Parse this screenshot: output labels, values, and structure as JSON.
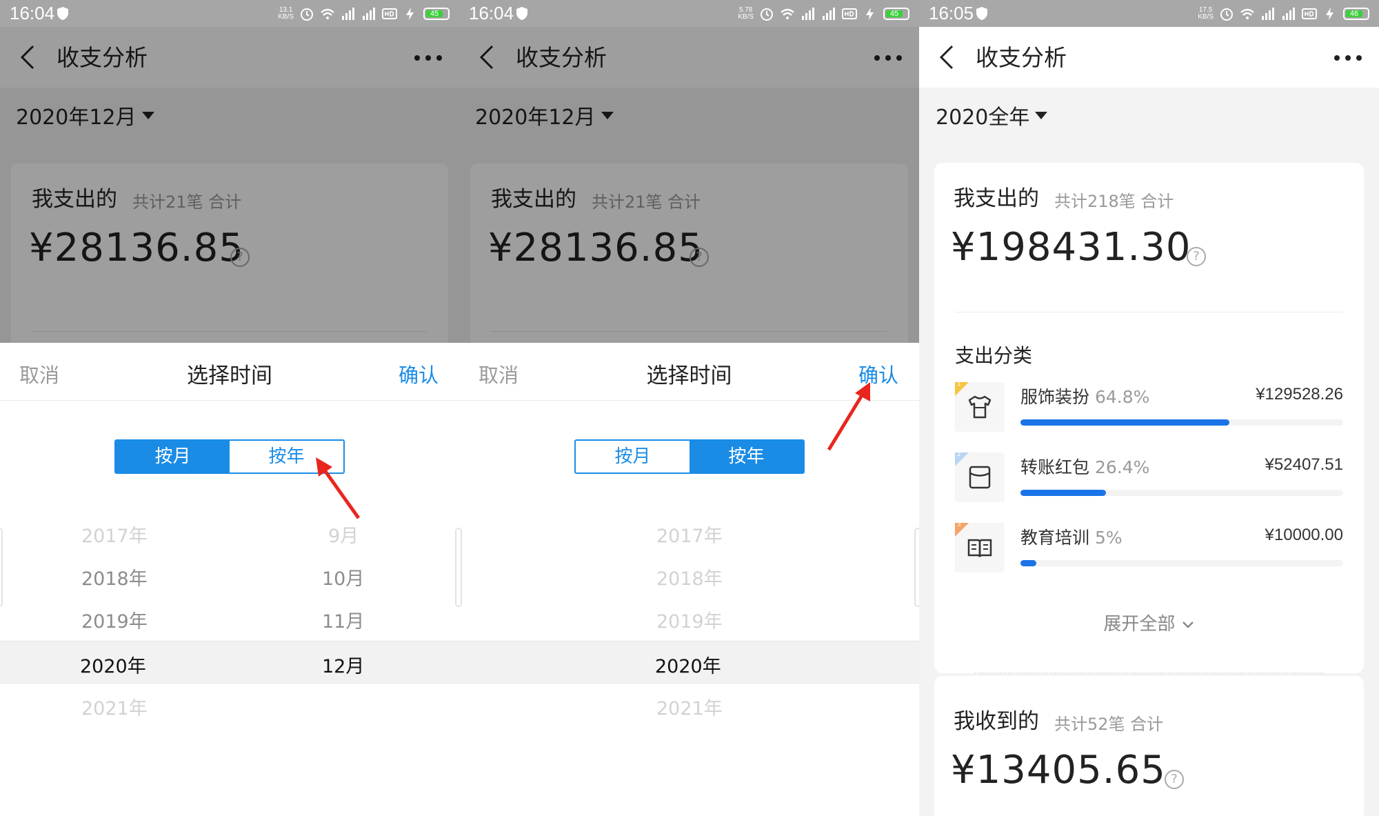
{
  "panels": [
    {
      "status": {
        "time": "16:04",
        "speed_top": "13.1",
        "speed_bottom": "KB/S",
        "battery": "45"
      },
      "title": "收支分析",
      "date_selector": "2020年12月",
      "card": {
        "title": "我支出的",
        "sub": "共计21笔 合计",
        "amount": "¥28136.85"
      },
      "sheet": {
        "cancel": "取消",
        "title": "选择时间",
        "confirm": "确认",
        "tab_month": "按月",
        "tab_year": "按年",
        "active": "month",
        "years": [
          "2017年",
          "2018年",
          "2019年",
          "2020年",
          "2021年"
        ],
        "months": [
          "9月",
          "10月",
          "11月",
          "12月"
        ]
      }
    },
    {
      "status": {
        "time": "16:04",
        "speed_top": "5.78",
        "speed_bottom": "KB/S",
        "battery": "45"
      },
      "title": "收支分析",
      "date_selector": "2020年12月",
      "card": {
        "title": "我支出的",
        "sub": "共计21笔 合计",
        "amount": "¥28136.85"
      },
      "sheet": {
        "cancel": "取消",
        "title": "选择时间",
        "confirm": "确认",
        "tab_month": "按月",
        "tab_year": "按年",
        "active": "year",
        "years": [
          "2017年",
          "2018年",
          "2019年",
          "2020年",
          "2021年"
        ]
      }
    },
    {
      "status": {
        "time": "16:05",
        "speed_top": "17.5",
        "speed_bottom": "KB/S",
        "battery": "46"
      },
      "title": "收支分析",
      "date_selector": "2020全年",
      "expense": {
        "title": "我支出的",
        "sub": "共计218笔 合计",
        "amount": "¥198431.30"
      },
      "category_title": "支出分类",
      "categories": [
        {
          "rank": "1",
          "name": "服饰装扮",
          "pct": "64.8%",
          "amount": "¥129528.26",
          "fraction": 0.648,
          "icon": "shirt-icon",
          "badge_color": "#f5c542"
        },
        {
          "rank": "2",
          "name": "转账红包",
          "pct": "26.4%",
          "amount": "¥52407.51",
          "fraction": 0.264,
          "icon": "envelope-icon",
          "badge_color": "#b9d7f2"
        },
        {
          "rank": "3",
          "name": "教育培训",
          "pct": "5%",
          "amount": "¥10000.00",
          "fraction": 0.05,
          "icon": "book-icon",
          "badge_color": "#f2a66a"
        }
      ],
      "expand": "展开全部",
      "income": {
        "title": "我收到的",
        "sub": "共计52笔 合计",
        "amount": "¥13405.65"
      }
    }
  ],
  "colors": {
    "accent": "#1a8ce6",
    "bar": "#1a73e8",
    "arrow": "#e8261e"
  }
}
